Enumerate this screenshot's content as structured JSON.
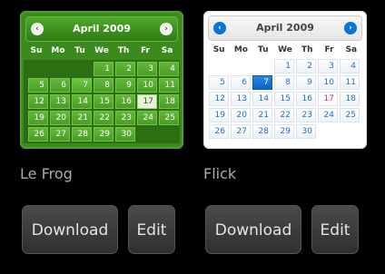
{
  "themes": [
    {
      "name": "Le Frog",
      "calendar": {
        "title": "April 2009",
        "prev_icon": "chevron-left-icon",
        "next_icon": "chevron-right-icon",
        "weekdays": [
          "Su",
          "Mo",
          "Tu",
          "We",
          "Th",
          "Fr",
          "Sa"
        ],
        "leading_blank_days": 3,
        "days": [
          "1",
          "2",
          "3",
          "4",
          "5",
          "6",
          "7",
          "8",
          "9",
          "10",
          "11",
          "12",
          "13",
          "14",
          "15",
          "16",
          "17",
          "18",
          "19",
          "20",
          "21",
          "22",
          "23",
          "24",
          "25",
          "26",
          "27",
          "28",
          "29",
          "30"
        ],
        "today": "7",
        "selected": "17"
      },
      "download_label": "Download",
      "edit_label": "Edit"
    },
    {
      "name": "Flick",
      "calendar": {
        "title": "April 2009",
        "prev_icon": "chevron-left-icon",
        "next_icon": "chevron-right-icon",
        "weekdays": [
          "Su",
          "Mo",
          "Tu",
          "We",
          "Th",
          "Fr",
          "Sa"
        ],
        "leading_blank_days": 3,
        "days": [
          "1",
          "2",
          "3",
          "4",
          "5",
          "6",
          "7",
          "8",
          "9",
          "10",
          "11",
          "12",
          "13",
          "14",
          "15",
          "16",
          "17",
          "18",
          "19",
          "20",
          "21",
          "22",
          "23",
          "24",
          "25",
          "26",
          "27",
          "28",
          "29",
          "30"
        ],
        "today": "7",
        "selected": "17"
      },
      "download_label": "Download",
      "edit_label": "Edit"
    }
  ],
  "colors": {
    "frog_accent": "#3a8a1e",
    "flick_accent": "#0a76d1",
    "flick_highlight": "#e0267b",
    "page_background": "#000000",
    "button_background": "#3a3a3a"
  }
}
